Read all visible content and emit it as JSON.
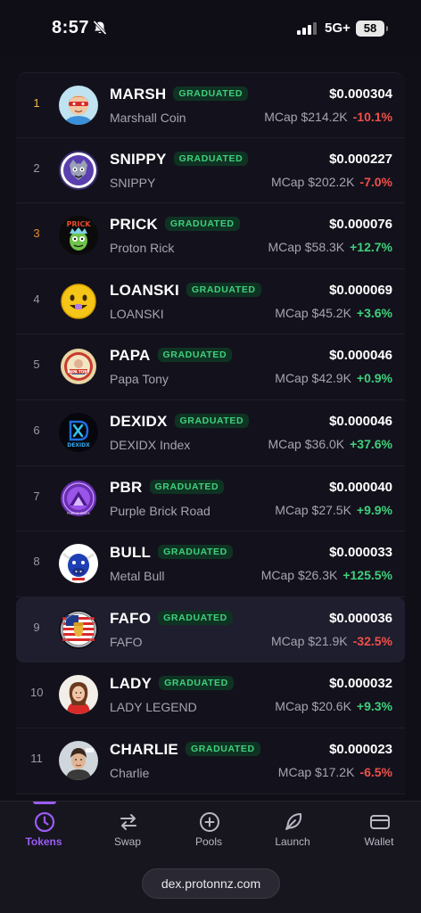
{
  "status": {
    "time": "8:57",
    "network": "5G+",
    "battery": "58"
  },
  "badge_text": "GRADUATED",
  "mcap_prefix": "MCap",
  "tokens": [
    {
      "rank": "1",
      "symbol": "MARSH",
      "name": "Marshall Coin",
      "price": "$0.000304",
      "mcap": "$214.2K",
      "change": "-10.1%",
      "direction": "down",
      "rank_color": "gold"
    },
    {
      "rank": "2",
      "symbol": "SNIPPY",
      "name": "SNIPPY",
      "price": "$0.000227",
      "mcap": "$202.2K",
      "change": "-7.0%",
      "direction": "down",
      "rank_color": "silver"
    },
    {
      "rank": "3",
      "symbol": "PRICK",
      "name": "Proton Rick",
      "price": "$0.000076",
      "mcap": "$58.3K",
      "change": "+12.7%",
      "direction": "up",
      "rank_color": "bronze"
    },
    {
      "rank": "4",
      "symbol": "LOANSKI",
      "name": "LOANSKI",
      "price": "$0.000069",
      "mcap": "$45.2K",
      "change": "+3.6%",
      "direction": "up",
      "rank_color": "plain"
    },
    {
      "rank": "5",
      "symbol": "PAPA",
      "name": "Papa Tony",
      "price": "$0.000046",
      "mcap": "$42.9K",
      "change": "+0.9%",
      "direction": "up",
      "rank_color": "plain"
    },
    {
      "rank": "6",
      "symbol": "DEXIDX",
      "name": "DEXIDX Index",
      "price": "$0.000046",
      "mcap": "$36.0K",
      "change": "+37.6%",
      "direction": "up",
      "rank_color": "plain"
    },
    {
      "rank": "7",
      "symbol": "PBR",
      "name": "Purple Brick Road",
      "price": "$0.000040",
      "mcap": "$27.5K",
      "change": "+9.9%",
      "direction": "up",
      "rank_color": "plain"
    },
    {
      "rank": "8",
      "symbol": "BULL",
      "name": "Metal Bull",
      "price": "$0.000033",
      "mcap": "$26.3K",
      "change": "+125.5%",
      "direction": "up",
      "rank_color": "plain"
    },
    {
      "rank": "9",
      "symbol": "FAFO",
      "name": "FAFO",
      "price": "$0.000036",
      "mcap": "$21.9K",
      "change": "-32.5%",
      "direction": "down",
      "rank_color": "plain"
    },
    {
      "rank": "10",
      "symbol": "LADY",
      "name": "LADY LEGEND",
      "price": "$0.000032",
      "mcap": "$20.6K",
      "change": "+9.3%",
      "direction": "up",
      "rank_color": "plain"
    },
    {
      "rank": "11",
      "symbol": "CHARLIE",
      "name": "Charlie",
      "price": "$0.000023",
      "mcap": "$17.2K",
      "change": "-6.5%",
      "direction": "down",
      "rank_color": "plain"
    }
  ],
  "tabs": [
    {
      "label": "Tokens",
      "icon": "clock-icon",
      "active": true
    },
    {
      "label": "Swap",
      "icon": "swap-arrows-icon",
      "active": false
    },
    {
      "label": "Pools",
      "icon": "plus-circle-icon",
      "active": false
    },
    {
      "label": "Launch",
      "icon": "rocket-leaf-icon",
      "active": false
    },
    {
      "label": "Wallet",
      "icon": "wallet-card-icon",
      "active": false
    }
  ],
  "url": "dex.protonnz.com",
  "colors": {
    "accent": "#9a5cf5",
    "up": "#3fd07c",
    "down": "#f0504a",
    "badge_bg": "#0f3323",
    "background": "#0f0e17"
  }
}
